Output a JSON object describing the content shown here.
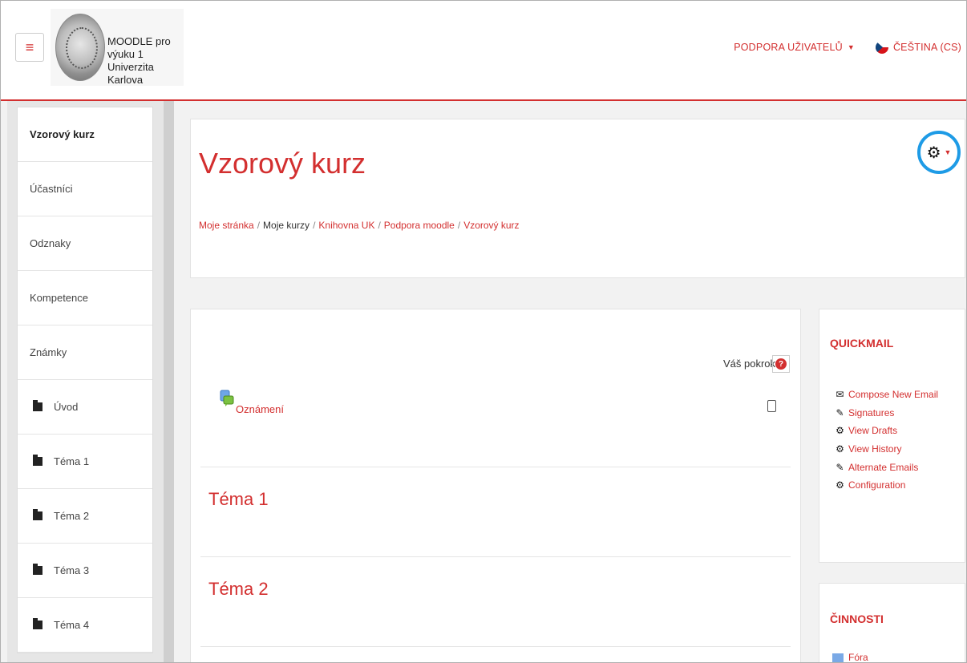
{
  "header": {
    "menu_icon": "hamburger-icon",
    "site_name_line1": "MOODLE pro výuku 1",
    "site_name_line2": "Univerzita Karlova",
    "support_menu": "PODPORA UŽIVATELŮ",
    "language_menu": "ČEŠTINA (CS)",
    "accent_color": "#d32f2f"
  },
  "sidebar": {
    "items": [
      {
        "label": "Vzorový kurz",
        "icon": null
      },
      {
        "label": "Účastníci",
        "icon": null
      },
      {
        "label": "Odznaky",
        "icon": null
      },
      {
        "label": "Kompetence",
        "icon": null
      },
      {
        "label": "Známky",
        "icon": null
      },
      {
        "label": "Úvod",
        "icon": "folder-icon"
      },
      {
        "label": "Téma 1",
        "icon": "folder-icon"
      },
      {
        "label": "Téma 2",
        "icon": "folder-icon"
      },
      {
        "label": "Téma 3",
        "icon": "folder-icon"
      },
      {
        "label": "Téma 4",
        "icon": "folder-icon"
      }
    ]
  },
  "page": {
    "title": "Vzorový kurz",
    "breadcrumb": [
      "Moje stránka",
      "Moje kurzy",
      "Knihovna UK",
      "Podpora moodle",
      "Vzorový kurz"
    ],
    "settings_icon": "gear-icon",
    "highlight_color": "#1e9be6"
  },
  "course": {
    "progress_label": "Váš pokrok",
    "announcements_label": "Oznámení",
    "sections": [
      "Téma 1",
      "Téma 2"
    ]
  },
  "blocks": {
    "quickmail": {
      "title": "QUICKMAIL",
      "items": [
        {
          "label": "Compose New Email",
          "icon": "envelope-icon"
        },
        {
          "label": "Signatures",
          "icon": "pencil-icon"
        },
        {
          "label": "View Drafts",
          "icon": "gear-icon"
        },
        {
          "label": "View History",
          "icon": "gear-icon"
        },
        {
          "label": "Alternate Emails",
          "icon": "pencil-icon"
        },
        {
          "label": "Configuration",
          "icon": "gear-icon"
        }
      ]
    },
    "activities": {
      "title": "ČINNOSTI",
      "first_item": "Fóra"
    }
  }
}
